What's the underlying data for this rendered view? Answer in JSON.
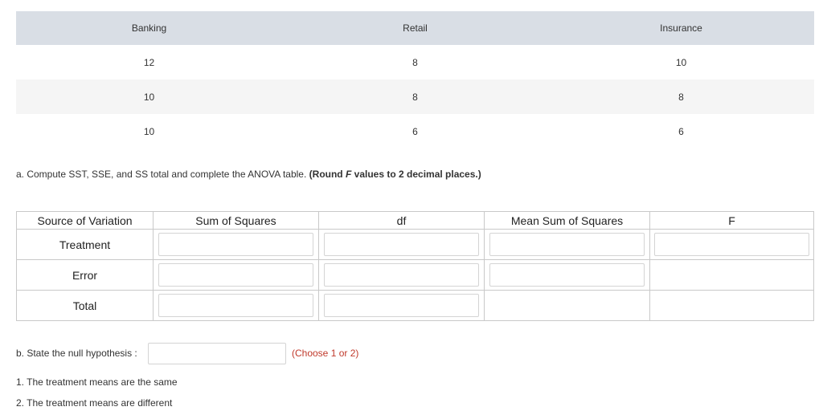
{
  "data_table": {
    "headers": [
      "Banking",
      "Retail",
      "Insurance"
    ],
    "rows": [
      [
        "12",
        "8",
        "10"
      ],
      [
        "10",
        "8",
        "8"
      ],
      [
        "10",
        "6",
        "6"
      ]
    ]
  },
  "question_a": {
    "text": "a. Compute SST, SSE, and SS total and complete the ANOVA table. ",
    "bold_prefix": "(Round ",
    "bold_italic": "F",
    "bold_suffix": " values to 2 decimal places.)"
  },
  "anova": {
    "headers": [
      "Source of Variation",
      "Sum of Squares",
      "df",
      "Mean Sum of Squares",
      "F"
    ],
    "rows": [
      "Treatment",
      "Error",
      "Total"
    ]
  },
  "question_b": {
    "label": "b. State the null hypothesis :",
    "choose_label": "(Choose 1 or 2)",
    "option1": "1. The treatment means are the same",
    "option2": "2. The treatment means are different"
  }
}
